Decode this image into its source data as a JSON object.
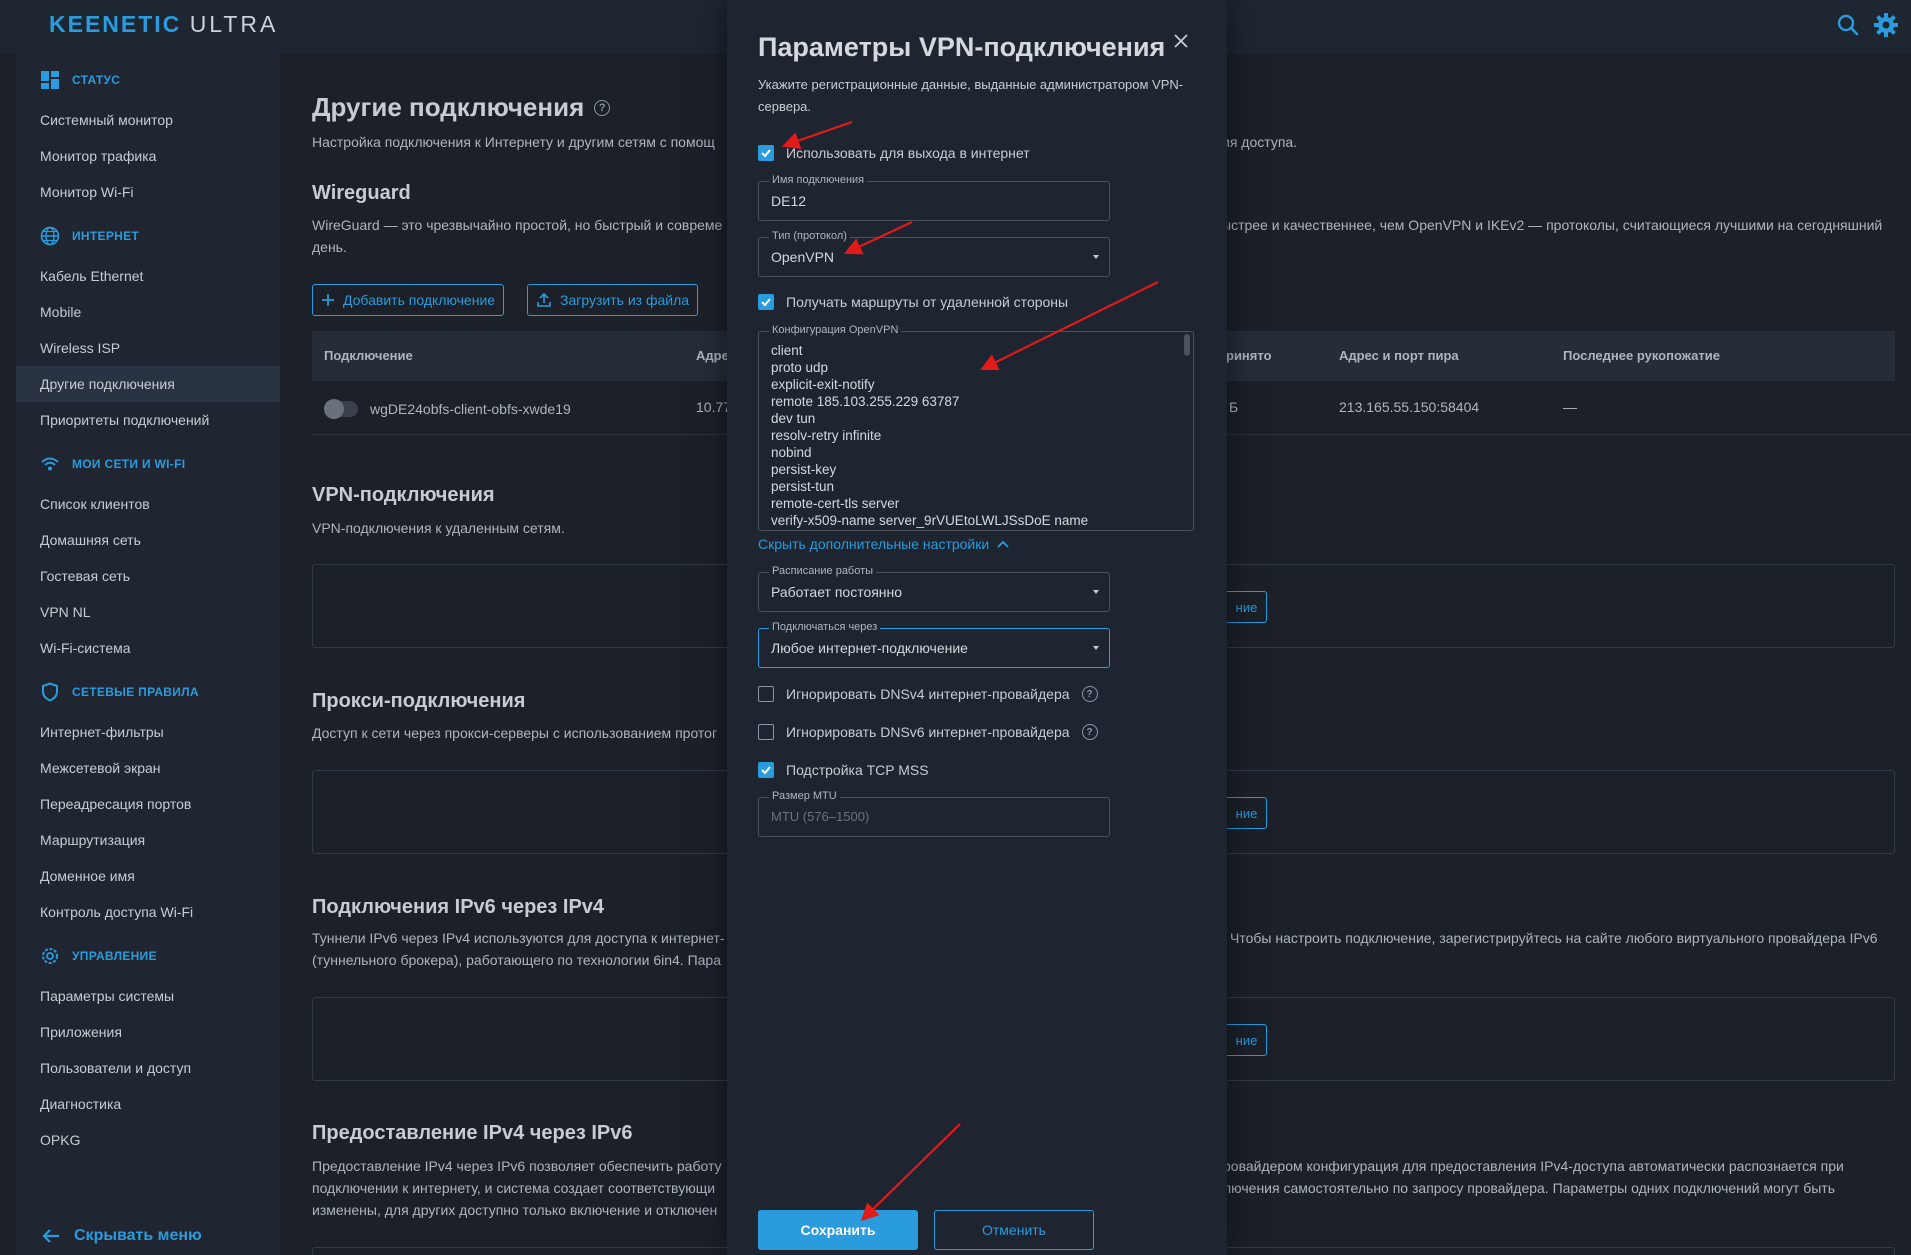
{
  "header": {
    "brand": "KEENETIC",
    "model": "ULTRA"
  },
  "sidebar": {
    "groups": [
      {
        "label": "Статус",
        "items": [
          "Системный монитор",
          "Монитор трафика",
          "Монитор Wi-Fi"
        ]
      },
      {
        "label": "Интернет",
        "items": [
          "Кабель Ethernet",
          "Mobile",
          "Wireless ISP",
          "Другие подключения",
          "Приоритеты подключений"
        ]
      },
      {
        "label": "Мои сети и Wi-Fi",
        "items": [
          "Список клиентов",
          "Домашняя сеть",
          "Гостевая сеть",
          "VPN NL",
          "Wi-Fi-система"
        ]
      },
      {
        "label": "Сетевые правила",
        "items": [
          "Интернет-фильтры",
          "Межсетевой экран",
          "Переадресация портов",
          "Маршрутизация",
          "Доменное имя",
          "Контроль доступа Wi-Fi"
        ]
      },
      {
        "label": "Управление",
        "items": [
          "Параметры системы",
          "Приложения",
          "Пользователи и доступ",
          "Диагностика",
          "OPKG"
        ]
      }
    ],
    "hide_menu": "Скрывать меню"
  },
  "main": {
    "title": "Другие подключения",
    "subtitle_left": "Настройка подключения к Интернету и другим сетям с помощ",
    "subtitle_right": "ия доступа.",
    "wireguard": {
      "title": "Wireguard",
      "desc_left": "WireGuard — это чрезвычайно простой, но быстрый и совреме",
      "desc_left2": "день.",
      "desc_right": "ыстрее и качественнее, чем OpenVPN и IKEv2 — протоколы, считающиеся лучшими на сегодняшний",
      "add_button": "Добавить подключение",
      "upload_button": "Загрузить из файла",
      "columns": [
        "Подключение",
        "Адре",
        "ринято",
        "Адрес и порт пира",
        "Последнее рукопожатие"
      ],
      "row": {
        "name": "wgDE24obfs-client-obfs-xwde19",
        "address": "10.77",
        "received": "Б",
        "peer": "213.165.55.150:58404",
        "handshake": "—"
      }
    },
    "vpn": {
      "title": "VPN-подключения",
      "desc": "VPN-подключения к удаленным сетям.",
      "btn_tail": "ние"
    },
    "proxy": {
      "title": "Прокси-подключения",
      "desc": "Доступ к сети через прокси-серверы с использованием протог",
      "btn_tail": "ние"
    },
    "ipv6": {
      "title": "Подключения IPv6 через IPv4",
      "desc_left": "Туннели IPv6 через IPv4 используются для доступа к интернет-",
      "desc_left2": "(туннельного брокера), работающего по технологии 6in4. Пара",
      "desc_right": "Чтобы настроить подключение, зарегистрируйтесь на сайте любого виртуального провайдера IPv6",
      "btn_tail": "ние"
    },
    "ipv4": {
      "title": "Предоставление IPv4 через IPv6",
      "desc_left": "Предоставление IPv4 через IPv6 позволяет обеспечить работу",
      "desc_left2": "подключении к интернету, и система создает соответствующи",
      "desc_left3": "изменены, для других доступно только включение и отключен",
      "desc_right": "ровайдером конфигурация для предоставления IPv4-доступа автоматически распознается при",
      "desc_right2": "лючения самостоятельно по запросу провайдера. Параметры одних подключений могут быть"
    }
  },
  "modal": {
    "title": "Параметры VPN-подключения",
    "desc": "Укажите регистрационные данные, выданные администратором VPN-сервера.",
    "use_internet": {
      "label": "Использовать для выхода в интернет",
      "checked": true
    },
    "name_field": {
      "label": "Имя подключения",
      "value": "DE12"
    },
    "type_field": {
      "label": "Тип (протокол)",
      "value": "OpenVPN"
    },
    "routes": {
      "label": "Получать маршруты от удаленной стороны",
      "checked": true
    },
    "config": {
      "label": "Конфигурация OpenVPN",
      "text": "client\nproto udp\nexplicit-exit-notify\nremote 185.103.255.229 63787\ndev tun\nresolv-retry infinite\nnobind\npersist-key\npersist-tun\nremote-cert-tls server\nverify-x509-name server_9rVUEtoLWLJSsDoE name"
    },
    "hide_advanced": "Скрыть дополнительные настройки",
    "schedule": {
      "label": "Расписание работы",
      "value": "Работает постоянно"
    },
    "connect_via": {
      "label": "Подключаться через",
      "value": "Любое интернет-подключение"
    },
    "ignore_dns4": {
      "label": "Игнорировать DNSv4 интернет-провайдера",
      "checked": false
    },
    "ignore_dns6": {
      "label": "Игнорировать DNSv6 интернет-провайдера",
      "checked": false
    },
    "tcp_mss": {
      "label": "Подстройка TCP MSS",
      "checked": true
    },
    "mtu": {
      "label": "Размер MTU",
      "placeholder": "MTU (576–1500)"
    },
    "save": "Сохранить",
    "cancel": "Отменить"
  },
  "colors": {
    "accent": "#2a9bdc",
    "annotation": "#e11a1a",
    "background": "#1b2029",
    "modal": "#1e2531"
  }
}
